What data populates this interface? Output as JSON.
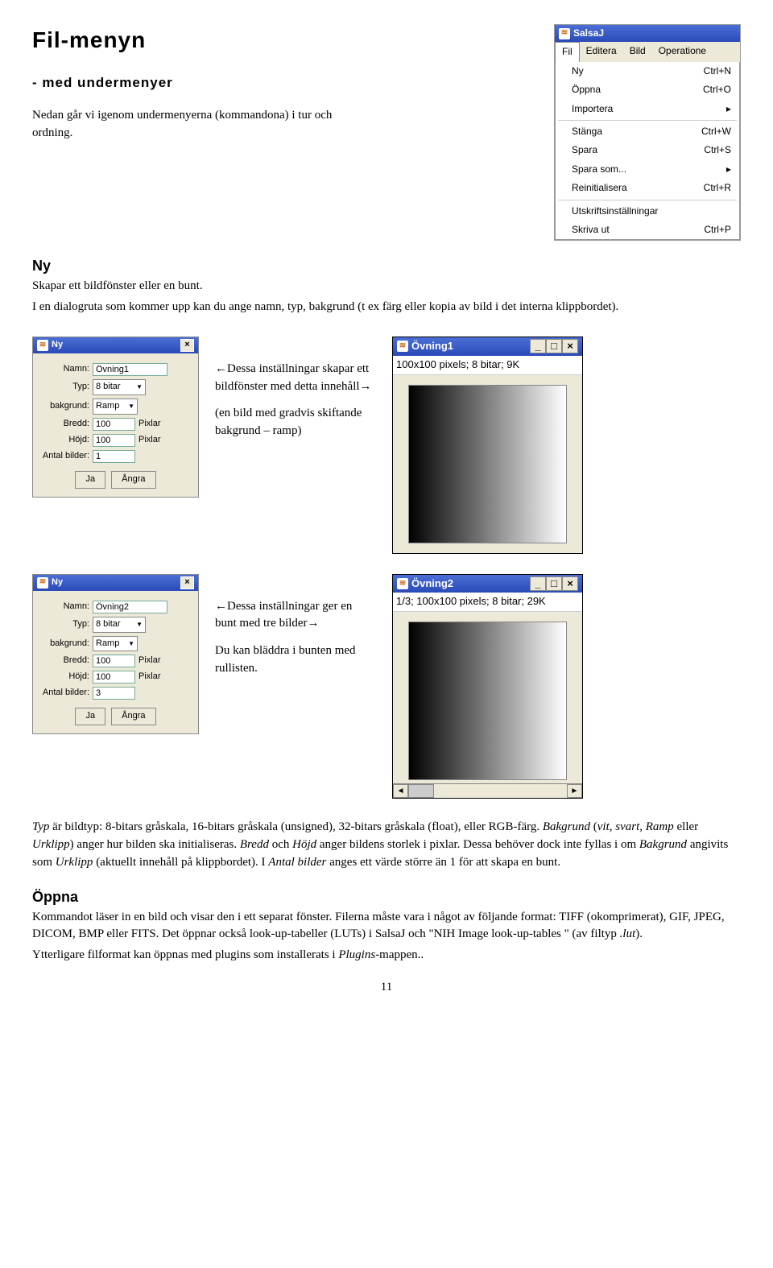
{
  "page": {
    "title": "Fil-menyn",
    "subtitle": "- med undermenyer",
    "intro": "Nedan går vi igenom undermenyerna (kommandona) i tur och ordning.",
    "section_ny_title": "Ny",
    "section_ny_l1": "Skapar ett bildfönster eller en bunt.",
    "section_ny_l2": "I en dialogruta som kommer upp kan du ange namn, typ, bakgrund (t ex färg eller kopia av bild i det interna klippbordet).",
    "caption1a": "←Dessa inställningar skapar ett bildfönster med detta innehåll→",
    "caption1b": "(en bild med gradvis skiftande bakgrund – ramp)",
    "caption2a": "←Dessa inställningar ger en bunt med tre bilder→",
    "caption2b": "Du kan bläddra i bunten med rullisten.",
    "body1_prefix": "Typ",
    "body1_a": " är bildtyp: 8-bitars gråskala, 16-bitars gråskala (unsigned), 32-bitars gråskala (float), eller RGB-färg. ",
    "body1_bakgrund": "Bakgrund",
    "body1_b": " (",
    "body1_vit": "vit, svart, Ramp",
    "body1_c": " eller ",
    "body1_urklipp": "Urklipp",
    "body1_d": ") anger hur bilden ska initialiseras. ",
    "body1_bredd": "Bredd",
    "body1_e": " och ",
    "body1_hojd": "Höjd",
    "body1_f": " anger bildens storlek i pixlar. Dessa behöver dock inte fyllas i om ",
    "body1_bak2": "Bakgrund",
    "body1_g": " angivits som ",
    "body1_urk2": "Urklipp",
    "body1_h": " (aktuellt innehåll på klippbordet). I ",
    "body1_antal": "Antal bilder",
    "body1_i": " anges ett värde större än 1 för att skapa en bunt.",
    "section_oppna_title": "Öppna",
    "oppna_p1": "Kommandot läser in en bild och visar den i ett separat fönster. Filerna måste vara i något av följande format: TIFF (okomprimerat), GIF, JPEG, DICOM, BMP eller FITS. Det öppnar också look-up-tabeller (LUTs) i SalsaJ och \"NIH Image look-up-tables \" (av filtyp ",
    "oppna_lut": ".lut",
    "oppna_p1end": ").",
    "oppna_p2a": "Ytterligare filformat kan öppnas med plugins som installerats i ",
    "oppna_plugins": "Plugins",
    "oppna_p2b": "-mappen..",
    "page_number": "11"
  },
  "menuwin": {
    "title": "SalsaJ",
    "tabs": {
      "fil": "Fil",
      "editera": "Editera",
      "bild": "Bild",
      "oper": "Operatione"
    },
    "items": [
      {
        "label": "Ny",
        "accel": "Ctrl+N"
      },
      {
        "label": "Öppna",
        "accel": "Ctrl+O"
      },
      {
        "label": "Importera",
        "accel": "▸"
      }
    ],
    "items2": [
      {
        "label": "Stänga",
        "accel": "Ctrl+W"
      },
      {
        "label": "Spara",
        "accel": "Ctrl+S"
      },
      {
        "label": "Spara som...",
        "accel": "▸"
      },
      {
        "label": "Reinitialisera",
        "accel": "Ctrl+R"
      }
    ],
    "items3": [
      {
        "label": "Utskriftsinställningar",
        "accel": ""
      },
      {
        "label": "Skriva ut",
        "accel": "Ctrl+P"
      }
    ]
  },
  "dialog1": {
    "title": "Ny",
    "namn_label": "Namn:",
    "namn": "Övning1",
    "typ_label": "Typ:",
    "typ": "8 bitar",
    "bak_label": "bakgrund:",
    "bak": "Ramp",
    "bredd_label": "Bredd:",
    "bredd": "100",
    "pixlar": "Pixlar",
    "hojd_label": "Höjd:",
    "hojd": "100",
    "pixlar2": "Pixlar",
    "antal_label": "Antal bilder:",
    "antal": "1",
    "ok": "Ja",
    "cancel": "Ångra"
  },
  "dialog2": {
    "title": "Ny",
    "namn": "Övning2",
    "antal": "3"
  },
  "imgwin1": {
    "title": "Övning1",
    "info": "100x100 pixels; 8 bitar; 9K"
  },
  "imgwin2": {
    "title": "Övning2",
    "info": "1/3; 100x100 pixels; 8 bitar; 29K"
  }
}
